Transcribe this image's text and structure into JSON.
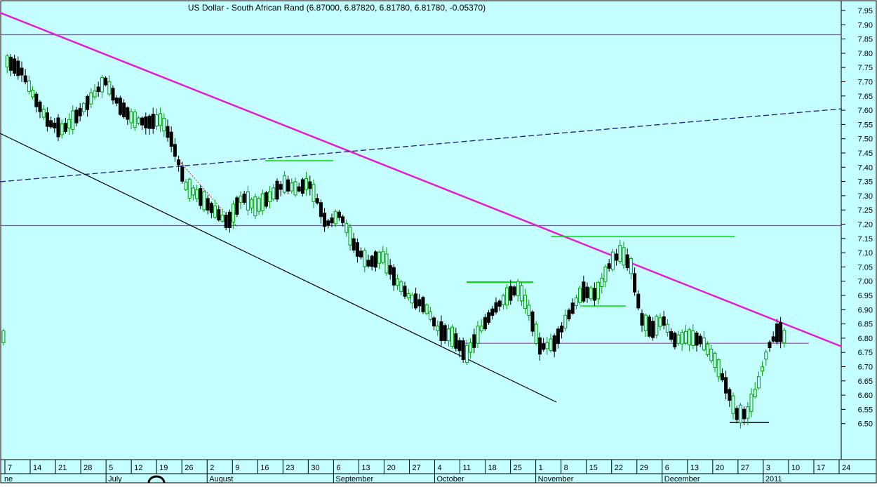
{
  "chart_data": {
    "type": "candlestick",
    "title": "US Dollar - South African Rand (6.87000, 6.87820, 6.81780, 6.81780, -0.05370)",
    "ylim": [
      6.48,
      7.98
    ],
    "yticks": [
      "7.95",
      "7.90",
      "7.85",
      "7.80",
      "7.75",
      "7.70",
      "7.65",
      "7.60",
      "7.55",
      "7.50",
      "7.45",
      "7.40",
      "7.35",
      "7.30",
      "7.25",
      "7.20",
      "7.15",
      "7.10",
      "7.05",
      "7.00",
      "6.95",
      "6.90",
      "6.85",
      "6.80",
      "6.75",
      "6.70",
      "6.65",
      "6.60",
      "6.55",
      "6.50"
    ],
    "day_ticks": [
      "7",
      "14",
      "21",
      "28",
      "5",
      "12",
      "19",
      "26",
      "2",
      "9",
      "16",
      "23",
      "30",
      "6",
      "13",
      "20",
      "27",
      "4",
      "11",
      "18",
      "25",
      "1",
      "8",
      "15",
      "22",
      "29",
      "6",
      "13",
      "20",
      "27",
      "3",
      "10",
      "17",
      "24"
    ],
    "month_labels": [
      "ne",
      "July",
      "August",
      "September",
      "October",
      "November",
      "December",
      "2011"
    ],
    "horizontal_levels": [
      7.865,
      7.195,
      6.782
    ],
    "colors": {
      "background": "#c4feff",
      "bull_candle": "#00a000",
      "bear_candle": "#000000",
      "trend_magenta": "#e020d0",
      "level_magenta": "#d020c0",
      "dashed_trend": "#1a1a80",
      "channel_line": "#000000",
      "green_marks": "#00dd00"
    }
  }
}
